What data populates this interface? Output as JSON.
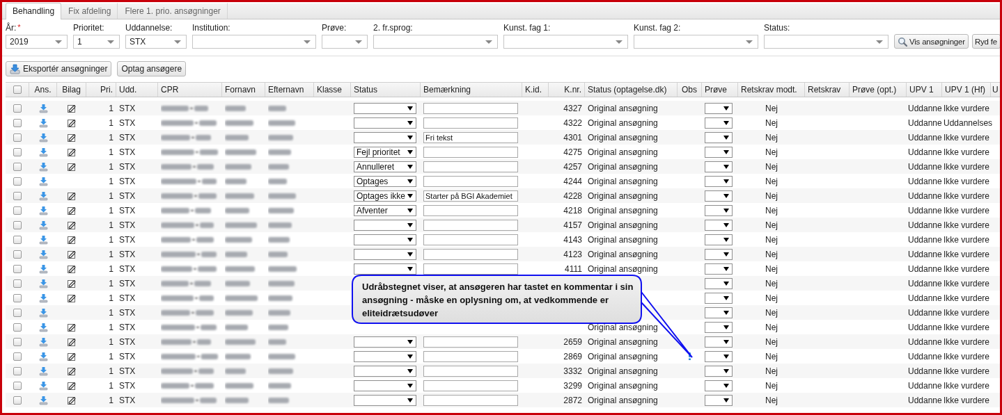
{
  "tabs": [
    {
      "label": "Behandling",
      "selected": true
    },
    {
      "label": "Fix afdeling",
      "selected": false
    },
    {
      "label": "Flere 1. prio. ansøgninger",
      "selected": false
    }
  ],
  "filters": [
    {
      "label": "År:",
      "required_mark": "*",
      "value": "2019"
    },
    {
      "label": "Prioritet:",
      "value": "1"
    },
    {
      "label": "Uddannelse:",
      "value": "STX"
    },
    {
      "label": "Institution:"
    },
    {
      "label": "Prøve:"
    },
    {
      "label": "2. fr.sprog:"
    },
    {
      "label": "Kunst. fag 1:"
    },
    {
      "label": "Kunst. fag 2:"
    },
    {
      "label": "Status:"
    }
  ],
  "filter_buttons": [
    {
      "label": "Vis ansøgninger",
      "kind": "search"
    },
    {
      "label": "Ryd fe",
      "kind": "plain"
    }
  ],
  "toolbar": [
    {
      "label": "Eksportér ansøgninger",
      "kind": "download"
    },
    {
      "label": "Optag ansøgere",
      "kind": "plain"
    }
  ],
  "table": {
    "select_all": {
      "checked": false
    },
    "columns": [
      "Ans.",
      "Bilag",
      "Pri.",
      "Udd.",
      "CPR",
      "Fornavn",
      "Efternavn",
      "Klasse",
      "Status",
      "Bemærkning",
      "K.id.",
      "K.nr.",
      "Status (optagelse.dk)",
      "Obs",
      "Prøve",
      "Retskrav modt.",
      "Retskrav",
      "Prøve (opt.)",
      "UPV 1",
      "UPV 1 (Hf)",
      "U"
    ],
    "rows": [
      {
        "checked": false,
        "attachment": true,
        "pri": "1",
        "udd": "STX",
        "entry_fields_shown": true,
        "knr": "4327",
        "status_dk": "Original ansøgning",
        "comment": false,
        "retskrav_modt": "Nej",
        "upv1": "Uddanne",
        "upv1_hf": "Ikke vurdere"
      },
      {
        "checked": false,
        "attachment": true,
        "pri": "1",
        "udd": "STX",
        "entry_fields_shown": true,
        "knr": "4322",
        "status_dk": "Original ansøgning",
        "comment": false,
        "retskrav_modt": "Nej",
        "upv1": "Uddanne",
        "upv1_hf": "Uddannelses"
      },
      {
        "checked": false,
        "attachment": true,
        "pri": "1",
        "udd": "STX",
        "entry_fields_shown": true,
        "remark": "Fri tekst",
        "knr": "4301",
        "status_dk": "Original ansøgning",
        "comment": false,
        "retskrav_modt": "Nej",
        "upv1": "Uddanne",
        "upv1_hf": "Ikke vurdere"
      },
      {
        "checked": false,
        "attachment": true,
        "pri": "1",
        "udd": "STX",
        "entry_fields_shown": true,
        "status": "Fejl prioritet",
        "knr": "4275",
        "status_dk": "Original ansøgning",
        "comment": false,
        "retskrav_modt": "Nej",
        "upv1": "Uddanne",
        "upv1_hf": "Ikke vurdere"
      },
      {
        "checked": false,
        "attachment": true,
        "pri": "1",
        "udd": "STX",
        "entry_fields_shown": true,
        "status": "Annulleret",
        "knr": "4257",
        "status_dk": "Original ansøgning",
        "comment": false,
        "retskrav_modt": "Nej",
        "upv1": "Uddanne",
        "upv1_hf": "Ikke vurdere"
      },
      {
        "checked": false,
        "attachment": false,
        "pri": "1",
        "udd": "STX",
        "entry_fields_shown": true,
        "status": "Optages",
        "knr": "4244",
        "status_dk": "Original ansøgning",
        "comment": false,
        "retskrav_modt": "Nej",
        "upv1": "Uddanne",
        "upv1_hf": "Ikke vurdere"
      },
      {
        "checked": false,
        "attachment": true,
        "pri": "1",
        "udd": "STX",
        "entry_fields_shown": true,
        "status": "Optages ikke",
        "remark": "Starter på BGI Akademiet",
        "knr": "4228",
        "status_dk": "Original ansøgning",
        "comment": false,
        "retskrav_modt": "Nej",
        "upv1": "Uddanne",
        "upv1_hf": "Ikke vurdere"
      },
      {
        "checked": false,
        "attachment": true,
        "pri": "1",
        "udd": "STX",
        "entry_fields_shown": true,
        "status": "Afventer",
        "knr": "4218",
        "status_dk": "Original ansøgning",
        "comment": false,
        "retskrav_modt": "Nej",
        "upv1": "Uddanne",
        "upv1_hf": "Ikke vurdere"
      },
      {
        "checked": false,
        "attachment": true,
        "pri": "1",
        "udd": "STX",
        "entry_fields_shown": true,
        "knr": "4157",
        "status_dk": "Original ansøgning",
        "comment": false,
        "retskrav_modt": "Nej",
        "upv1": "Uddanne",
        "upv1_hf": "Ikke vurdere"
      },
      {
        "checked": false,
        "attachment": true,
        "pri": "1",
        "udd": "STX",
        "entry_fields_shown": true,
        "knr": "4143",
        "status_dk": "Original ansøgning",
        "comment": false,
        "retskrav_modt": "Nej",
        "upv1": "Uddanne",
        "upv1_hf": "Ikke vurdere"
      },
      {
        "checked": false,
        "attachment": true,
        "pri": "1",
        "udd": "STX",
        "entry_fields_shown": true,
        "knr": "4123",
        "status_dk": "Original ansøgning",
        "comment": false,
        "retskrav_modt": "Nej",
        "upv1": "Uddanne",
        "upv1_hf": "Ikke vurdere"
      },
      {
        "checked": false,
        "attachment": true,
        "pri": "1",
        "udd": "STX",
        "entry_fields_shown": true,
        "knr": "4111",
        "status_dk": "Original ansøgning",
        "comment": false,
        "retskrav_modt": "Nej",
        "upv1": "Uddanne",
        "upv1_hf": "Ikke vurdere"
      },
      {
        "checked": false,
        "attachment": true,
        "pri": "1",
        "udd": "STX",
        "entry_fields_shown": false,
        "comment": false,
        "retskrav_modt": "Nej",
        "upv1": "Uddanne",
        "upv1_hf": "Ikke vurdere"
      },
      {
        "checked": false,
        "attachment": true,
        "pri": "1",
        "udd": "STX",
        "entry_fields_shown": false,
        "comment": false,
        "retskrav_modt": "Nej",
        "upv1": "Uddanne",
        "upv1_hf": "Ikke vurdere"
      },
      {
        "checked": false,
        "attachment": false,
        "pri": "1",
        "udd": "STX",
        "entry_fields_shown": false,
        "comment": false,
        "retskrav_modt": "Nej",
        "upv1": "Uddanne",
        "upv1_hf": "Ikke vurdere"
      },
      {
        "checked": false,
        "attachment": true,
        "pri": "1",
        "udd": "STX",
        "entry_fields_shown": false,
        "status_dk": "Original ansøgning",
        "comment": false,
        "retskrav_modt": "Nej",
        "upv1": "Uddanne",
        "upv1_hf": "Ikke vurdere"
      },
      {
        "checked": false,
        "attachment": true,
        "pri": "1",
        "udd": "STX",
        "entry_fields_shown": true,
        "knr": "2659",
        "status_dk": "Original ansøgning",
        "comment": false,
        "retskrav_modt": "Nej",
        "upv1": "Uddanne",
        "upv1_hf": "Ikke vurdere"
      },
      {
        "checked": false,
        "attachment": true,
        "pri": "1",
        "udd": "STX",
        "entry_fields_shown": true,
        "knr": "2869",
        "status_dk": "Original ansøgning",
        "comment": true,
        "retskrav_modt": "Nej",
        "upv1": "Uddanne",
        "upv1_hf": "Ikke vurdere"
      },
      {
        "checked": false,
        "attachment": true,
        "pri": "1",
        "udd": "STX",
        "entry_fields_shown": true,
        "knr": "3332",
        "status_dk": "Original ansøgning",
        "comment": false,
        "retskrav_modt": "Nej",
        "upv1": "Uddanne",
        "upv1_hf": "Ikke vurdere"
      },
      {
        "checked": false,
        "attachment": true,
        "pri": "1",
        "udd": "STX",
        "entry_fields_shown": true,
        "knr": "3299",
        "status_dk": "Original ansøgning",
        "comment": false,
        "retskrav_modt": "Nej",
        "upv1": "Uddanne",
        "upv1_hf": "Ikke vurdere"
      },
      {
        "checked": false,
        "attachment": true,
        "pri": "1",
        "udd": "STX",
        "entry_fields_shown": true,
        "knr": "2872",
        "status_dk": "Original ansøgning",
        "comment": false,
        "retskrav_modt": "Nej",
        "upv1": "Uddanne",
        "upv1_hf": "Ikke vurdere"
      }
    ]
  },
  "callout": {
    "text": "Udråbstegnet viser, at ansøgeren har tastet en kommentar i sin ansøgning - måske en oplysning om, at vedkommende er eliteidrætsudøver"
  }
}
